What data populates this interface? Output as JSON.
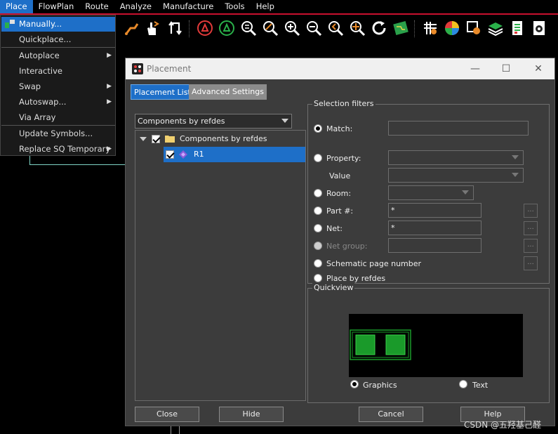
{
  "menubar": {
    "items": [
      "Place",
      "FlowPlan",
      "Route",
      "Analyze",
      "Manufacture",
      "Tools",
      "Help"
    ]
  },
  "toolbar": {
    "icons": [
      "interactive-route-icon",
      "hand-pointer-icon",
      "rotate-icon",
      "drc-icon",
      "drc-update-icon",
      "zoom-out-icon",
      "zoom-fit-icon",
      "zoom-in-icon",
      "zoom-out-minus-icon",
      "zoom-previous-icon",
      "zoom-center-icon",
      "redraw-icon",
      "pcb-icon",
      "grid-icon",
      "color-wheel-icon",
      "shadow-icon",
      "layers-icon",
      "report-icon",
      "settings-icon"
    ]
  },
  "place_menu": {
    "items": [
      {
        "label": "Manually...",
        "submenu": false
      },
      {
        "label": "Quickplace...",
        "submenu": false
      },
      {
        "label": "Autoplace",
        "submenu": true
      },
      {
        "label": "Interactive",
        "submenu": false
      },
      {
        "label": "Swap",
        "submenu": true
      },
      {
        "label": "Autoswap...",
        "submenu": true
      },
      {
        "label": "Via Array",
        "submenu": false
      },
      {
        "label": "Update Symbols...",
        "submenu": false
      },
      {
        "label": "Replace SQ Temporary",
        "submenu": true
      }
    ]
  },
  "dialog": {
    "title": "Placement",
    "tabs": [
      "Placement List",
      "Advanced Settings"
    ],
    "list_filter": "Components by refdes",
    "tree": {
      "root": "Components by refdes",
      "child": "R1"
    },
    "selection_filters": {
      "title": "Selection filters",
      "match_label": "Match:",
      "match_value": "",
      "property_label": "Property:",
      "value_label": "Value",
      "room_label": "Room:",
      "part_label": "Part #:",
      "part_value": "*",
      "net_label": "Net:",
      "net_value": "*",
      "netgroup_label": "Net group:",
      "schematic_label": "Schematic page number",
      "refdes_label": "Place by refdes",
      "ellipsis": "..."
    },
    "quickview": {
      "title": "Quickview",
      "graphics_label": "Graphics",
      "text_label": "Text"
    },
    "buttons": {
      "close": "Close",
      "hide": "Hide",
      "cancel": "Cancel",
      "help": "Help"
    },
    "window_controls": {
      "minimize": "—",
      "maximize": "☐",
      "close": "✕"
    }
  },
  "watermark": "CSDN @五羟基己醛",
  "colors": {
    "accent": "#1e6fc8",
    "menubar_underline": "#c8102e",
    "footprint_green": "#1a9a2a"
  }
}
